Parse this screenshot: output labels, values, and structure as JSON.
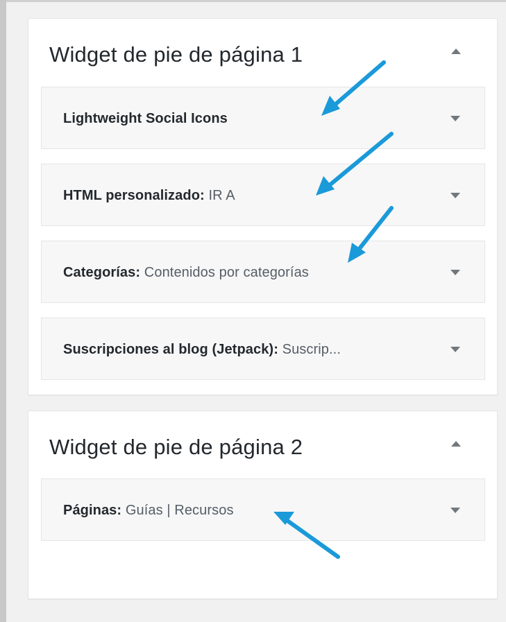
{
  "sidebars": [
    {
      "title": "Widget de pie de página 1",
      "widgets": [
        {
          "name": "Lightweight Social Icons",
          "sep": "",
          "in_title": ""
        },
        {
          "name": "HTML personalizado",
          "sep": ": ",
          "in_title": "IR A"
        },
        {
          "name": "Categorías",
          "sep": ": ",
          "in_title": "Contenidos por categorías"
        },
        {
          "name": "Suscripciones al blog (Jetpack)",
          "sep": ": ",
          "in_title": "Suscrip..."
        }
      ]
    },
    {
      "title": "Widget de pie de página 2",
      "widgets": [
        {
          "name": "Páginas",
          "sep": ": ",
          "in_title": "Guías | Recursos"
        }
      ]
    }
  ],
  "colors": {
    "annotation_arrow": "#1a9ad9",
    "panel_bg": "#ffffff",
    "widget_bg": "#f7f7f7",
    "text": "#23282d",
    "muted_text": "#555d66"
  }
}
